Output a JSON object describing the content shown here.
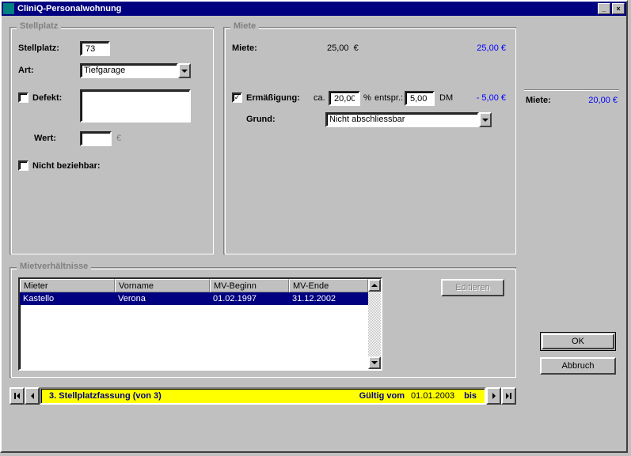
{
  "window_title": "CliniQ-Personalwohnung",
  "stellplatz": {
    "legend": "Stellplatz",
    "stellplatz_label": "Stellplatz:",
    "stellplatz_value": "73",
    "art_label": "Art:",
    "art_value": "Tiefgarage",
    "defekt_label": "Defekt:",
    "wert_label": "Wert:",
    "wert_value": "",
    "wert_currency": "€",
    "nicht_beziehbar_label": "Nicht beziehbar:"
  },
  "miete": {
    "legend": "Miete",
    "miete_label": "Miete:",
    "miete_amount": "25,00",
    "miete_currency": "€",
    "miete_calc": "25,00 €",
    "ermaessigung_checked": true,
    "ermaessigung_label": "Ermäßigung:",
    "ca_label": "ca.",
    "pct_value": "20,00",
    "pct_unit": "%",
    "entspr_label": "entspr.:",
    "abs_value": "5,00",
    "abs_unit": "DM",
    "erm_calc": "- 5,00 €",
    "grund_label": "Grund:",
    "grund_value": "Nicht abschliessbar"
  },
  "total": {
    "miete_label": "Miete:",
    "miete_value": "20,00 €"
  },
  "mietverhaeltnisse": {
    "legend": "Mietverhältnisse",
    "columns": [
      "Mieter",
      "Vorname",
      "MV-Beginn",
      "MV-Ende"
    ],
    "rows": [
      {
        "mieter": "Kastello",
        "vorname": "Verona",
        "beginn": "01.02.1997",
        "ende": "31.12.2002"
      }
    ],
    "editieren_label": "Editieren"
  },
  "nav": {
    "banner_text": "3. Stellplatzfassung (von  3)",
    "gueltig_vom_label": "Gültig vom",
    "gueltig_vom_value": "01.01.2003",
    "bis_label": "bis",
    "bis_value": ""
  },
  "buttons": {
    "ok": "OK",
    "abbruch": "Abbruch"
  }
}
